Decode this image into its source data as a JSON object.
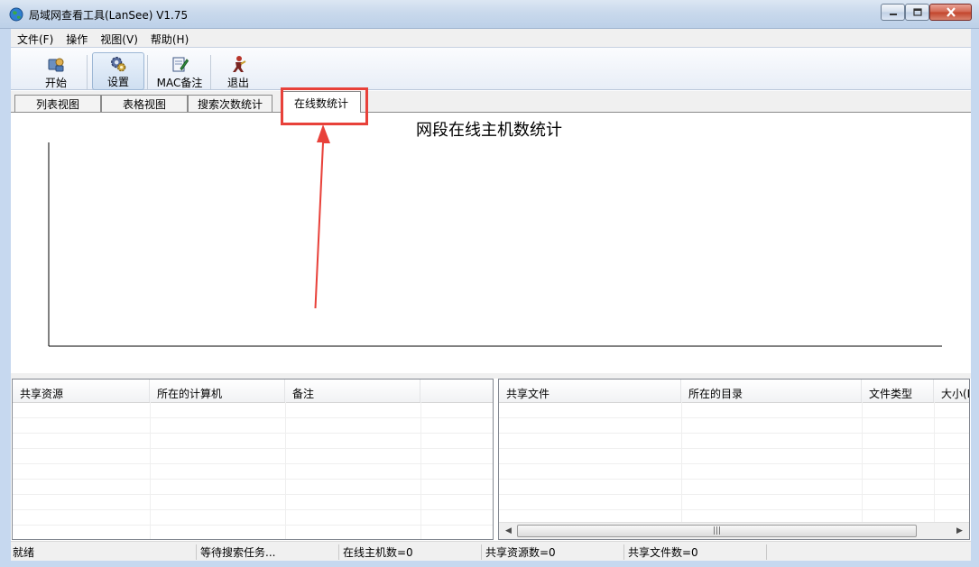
{
  "window": {
    "title": "局域网查看工具(LanSee) V1.75",
    "icon": "globe-icon"
  },
  "menu": [
    "文件(F)",
    "操作",
    "视图(V)",
    "帮助(H)"
  ],
  "toolbar": {
    "start_label": "开始",
    "settings_label": "设置",
    "mac_label": "MAC备注",
    "exit_label": "退出"
  },
  "tabs": [
    {
      "label": "列表视图",
      "active": false
    },
    {
      "label": "表格视图",
      "active": false
    },
    {
      "label": "搜索次数统计",
      "active": false
    },
    {
      "label": "在线数统计",
      "active": true
    }
  ],
  "chart_data": {
    "type": "bar",
    "title": "网段在线主机数统计",
    "categories": [],
    "values": [],
    "xlabel": "",
    "ylabel": ""
  },
  "left_list": {
    "columns": [
      "共享资源",
      "所在的计算机",
      "备注",
      ""
    ]
  },
  "right_list": {
    "columns": [
      "共享文件",
      "所在的目录",
      "文件类型",
      "大小(K"
    ]
  },
  "status": {
    "ready": "就绪",
    "task": "等待搜索任务...",
    "online_hosts": "在线主机数=0",
    "shares": "共享资源数=0",
    "files": "共享文件数=0"
  },
  "colors": {
    "highlight": "#e8413a",
    "frame": "#c6d8ef"
  }
}
